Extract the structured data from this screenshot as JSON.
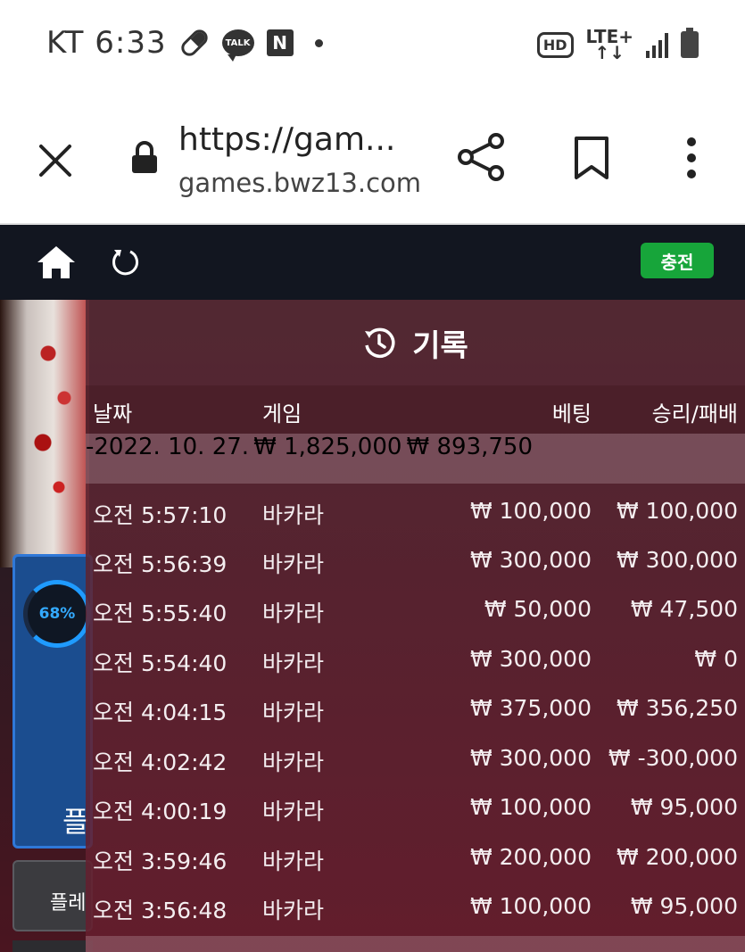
{
  "status_bar": {
    "carrier_time": "KT 6:33",
    "icons": [
      "pill-icon",
      "kakaotalk-icon",
      "naver-icon",
      "dot-icon",
      "hd-voice-icon",
      "lte-plus-icon",
      "signal-icon",
      "battery-icon"
    ],
    "talk_label": "TALK",
    "naver_label": "N",
    "hd_label": "HD",
    "lte_label": "LTE+"
  },
  "browser": {
    "page_title": "https://gam...",
    "host": "games.bwz13.com"
  },
  "game_nav": {
    "charge_label": "충전",
    "charge_color": "#17a53a"
  },
  "game_bg": {
    "progress_label": "68%",
    "progress_value": 0.68,
    "player_label": "플",
    "player_button_label": "플레"
  },
  "records": {
    "title": "기록",
    "columns": {
      "date": "날짜",
      "game": "게임",
      "bet": "베팅",
      "result": "승리/패배"
    },
    "summary": {
      "date": "-2022. 10. 27.",
      "bet": "₩ 1,825,000",
      "result": "₩ 893,750"
    },
    "rows": [
      {
        "time": "오전 5:57:10",
        "game": "바카라",
        "bet": "₩ 100,000",
        "result": "₩ 100,000"
      },
      {
        "time": "오전 5:56:39",
        "game": "바카라",
        "bet": "₩ 300,000",
        "result": "₩ 300,000"
      },
      {
        "time": "오전 5:55:40",
        "game": "바카라",
        "bet": "₩ 50,000",
        "result": "₩ 47,500"
      },
      {
        "time": "오전 5:54:40",
        "game": "바카라",
        "bet": "₩ 300,000",
        "result": "₩ 0"
      },
      {
        "time": "오전 4:04:15",
        "game": "바카라",
        "bet": "₩ 375,000",
        "result": "₩ 356,250"
      },
      {
        "time": "오전 4:02:42",
        "game": "바카라",
        "bet": "₩ 300,000",
        "result": "₩ -300,000"
      },
      {
        "time": "오전 4:00:19",
        "game": "바카라",
        "bet": "₩ 100,000",
        "result": "₩ 95,000"
      },
      {
        "time": "오전 3:59:46",
        "game": "바카라",
        "bet": "₩ 200,000",
        "result": "₩ 200,000"
      },
      {
        "time": "오전 3:56:48",
        "game": "바카라",
        "bet": "₩ 100,000",
        "result": "₩ 95,000"
      }
    ]
  }
}
